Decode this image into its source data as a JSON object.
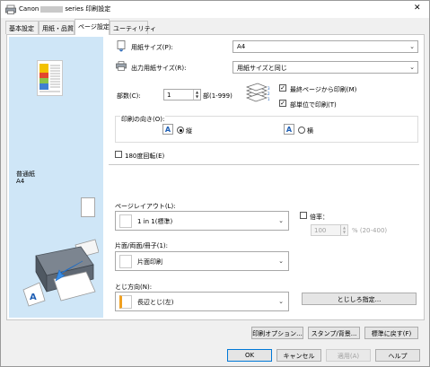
{
  "window": {
    "title_prefix": "Canon",
    "title_suffix": "series 印刷設定",
    "close_symbol": "✕"
  },
  "tabs": [
    {
      "label": "基本設定"
    },
    {
      "label": "用紙・品質"
    },
    {
      "label": "ページ設定"
    },
    {
      "label": "ユーティリティ"
    }
  ],
  "preview": {
    "media_type": "普通紙",
    "paper_size": "A4"
  },
  "page_setup": {
    "page_size_label": "用紙サイズ(P):",
    "page_size_value": "A4",
    "output_size_label": "出力用紙サイズ(R):",
    "output_size_value": "用紙サイズと同じ",
    "copies_label": "部数(C):",
    "copies_value": "1",
    "copies_range": "部(1-999)",
    "print_from_last_label": "最終ページから印刷(M)",
    "print_from_last_checked": "✓",
    "collate_label": "部単位で印刷(T)",
    "collate_checked": "✓",
    "orientation_group_label": "印刷の向き(O):",
    "portrait_label": "縦",
    "landscape_label": "横",
    "rotate_label": "180度回転(E)",
    "page_layout_label": "ページレイアウト(L):",
    "page_layout_value": "1 in 1(標準)",
    "scale_label": "倍率：",
    "scale_value": "100",
    "scale_range": "% (20-400)",
    "duplex_label": "片面/両面/冊子(1):",
    "duplex_value": "片面印刷",
    "staple_label": "とじ方向(N):",
    "staple_value": "長辺とじ(左)",
    "margin_button": "とじしろ指定..."
  },
  "bottom_buttons": {
    "print_options": "印刷オプション...",
    "stamp_background": "スタンプ/背景...",
    "defaults": "標準に戻す(F)"
  },
  "dialog_buttons": {
    "ok": "OK",
    "cancel": "キャンセル",
    "apply": "適用(A)",
    "help": "ヘルプ"
  }
}
